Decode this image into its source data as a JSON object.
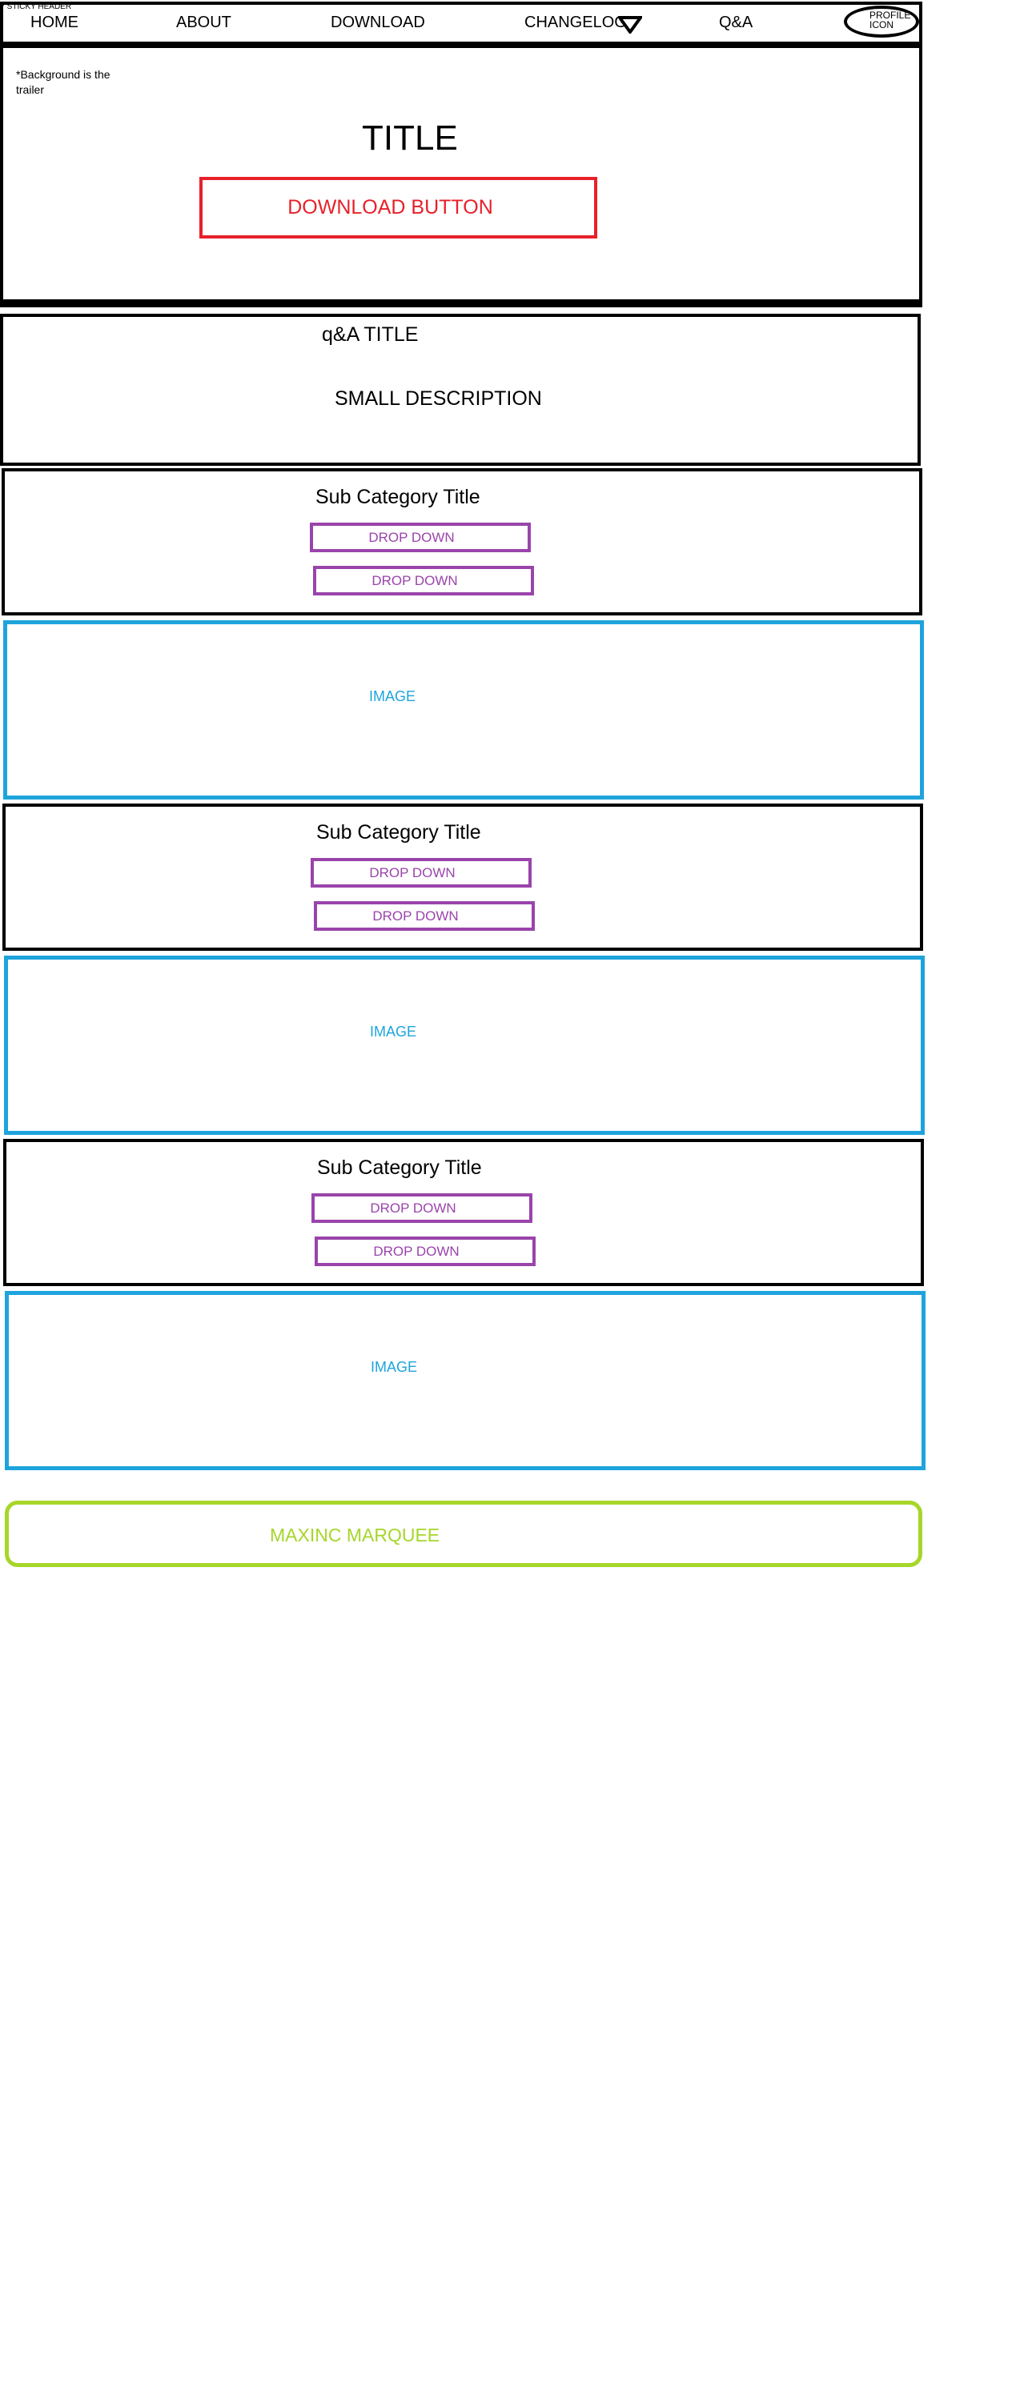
{
  "header": {
    "note": "* STICKY HEADER",
    "nav": [
      "HOME",
      "ABOUT",
      "DOWNLOAD",
      "CHANGELOG",
      "Q&A"
    ],
    "changelog_icon": "triangle-down-icon",
    "profile_label": "PROFILE ICON"
  },
  "hero": {
    "note": "*Background is the trailer",
    "title": "TITLE",
    "download_button": "DOWNLOAD BUTTON"
  },
  "qa": {
    "title": "q&A TITLE",
    "description": "SMALL DESCRIPTION"
  },
  "sections": [
    {
      "title": "Sub Category Title",
      "dropdowns": [
        "DROP DOWN",
        "DROP DOWN"
      ],
      "image_label": "IMAGE"
    },
    {
      "title": "Sub Category Title",
      "dropdowns": [
        "DROP DOWN",
        "DROP DOWN"
      ],
      "image_label": "IMAGE"
    },
    {
      "title": "Sub Category Title",
      "dropdowns": [
        "DROP DOWN",
        "DROP DOWN"
      ],
      "image_label": "IMAGE"
    }
  ],
  "marquee": {
    "label": "MAXINC MARQUEE"
  },
  "colors": {
    "download_button": "#e8202a",
    "dropdown": "#9a44ab",
    "image": "#1ea4dc",
    "marquee": "#a6d62a",
    "outline": "#000000"
  }
}
